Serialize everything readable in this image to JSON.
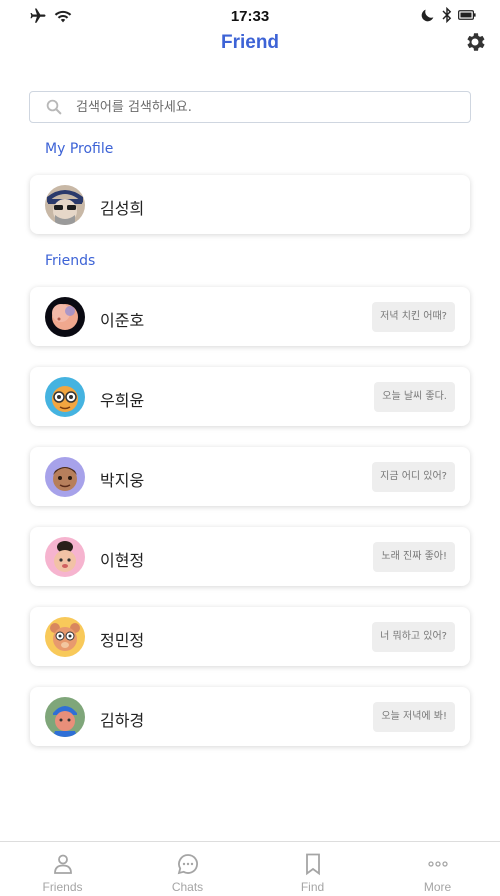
{
  "status_bar": {
    "time": "17:33"
  },
  "header": {
    "title": "Friend"
  },
  "search": {
    "placeholder": "검색어를 검색하세요."
  },
  "my_profile": {
    "section_label": "My Profile",
    "name": "김성희"
  },
  "friends": {
    "section_label": "Friends",
    "items": [
      {
        "name": "이준호",
        "message": "저녁 치킨 어때?"
      },
      {
        "name": "우희윤",
        "message": "오늘 날씨 좋다."
      },
      {
        "name": "박지웅",
        "message": "지금 어디 있어?"
      },
      {
        "name": "이현정",
        "message": "노래 진짜 좋아!"
      },
      {
        "name": "정민정",
        "message": "너 뭐하고 있어?"
      },
      {
        "name": "김하경",
        "message": "오늘 저녁에 봐!"
      }
    ]
  },
  "tab_bar": {
    "tabs": [
      {
        "label": "Friends",
        "icon": "person-icon"
      },
      {
        "label": "Chats",
        "icon": "chat-bubble-icon"
      },
      {
        "label": "Find",
        "icon": "bookmark-icon"
      },
      {
        "label": "More",
        "icon": "more-dots-icon"
      }
    ]
  },
  "colors": {
    "accent": "#3d63d6",
    "inactive_tab": "#a5a5a5",
    "message_bg": "#eeeeee"
  }
}
